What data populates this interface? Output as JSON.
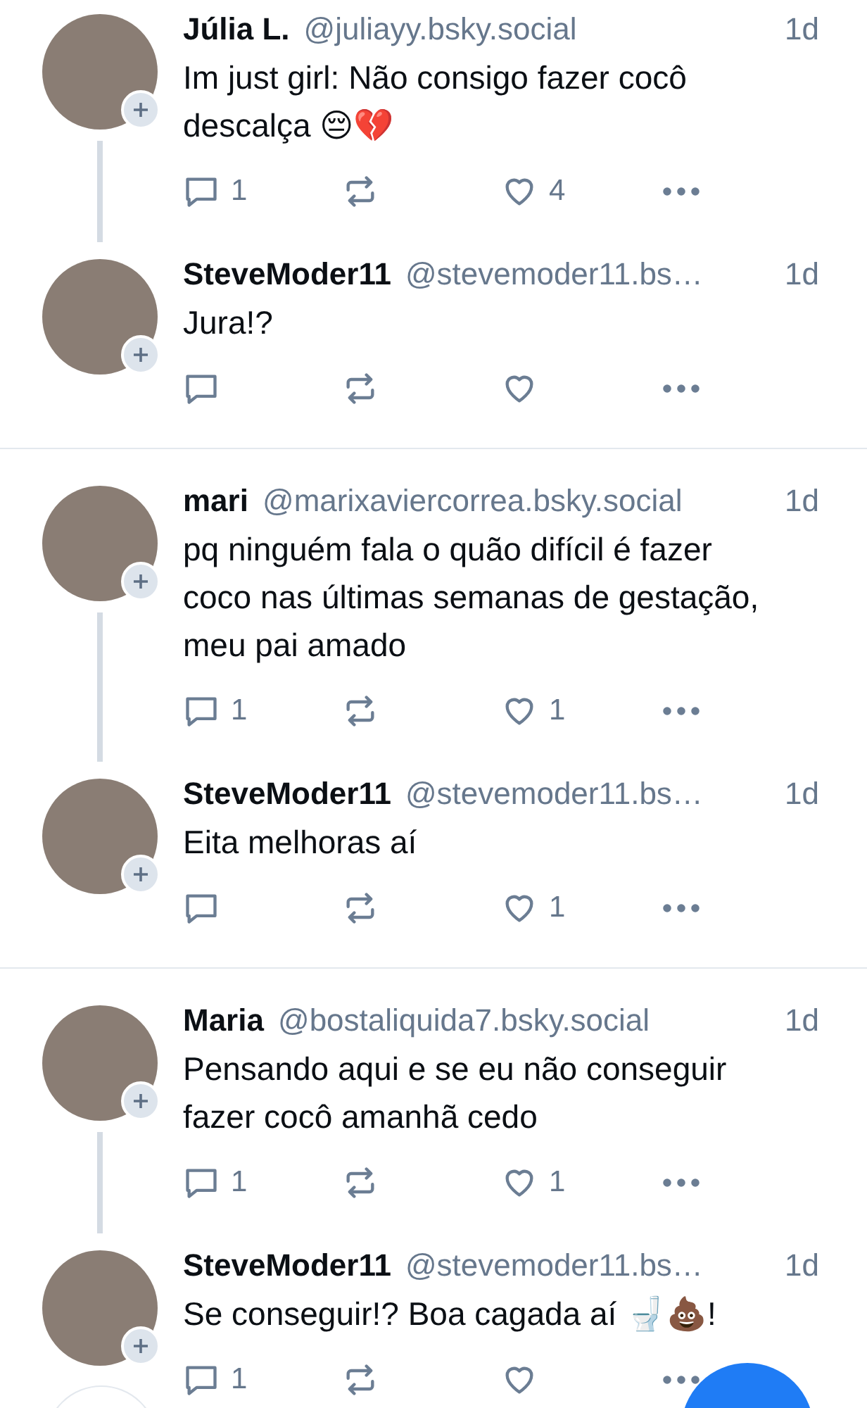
{
  "threads": [
    {
      "posts": [
        {
          "name": "Júlia L.",
          "handle": "@juliayy.bsky.social",
          "time": "1d",
          "text": "Im just girl: Não consigo fazer cocô descalça 😔💔",
          "replies": "1",
          "likes": "4",
          "liked": false
        },
        {
          "name": "SteveModer11",
          "handle": "@stevemoder11.bs…",
          "time": "1d",
          "text": "Jura!?",
          "liked": false
        }
      ]
    },
    {
      "posts": [
        {
          "name": "mari",
          "handle": "@marixaviercorrea.bsky.social",
          "time": "1d",
          "text": "pq ninguém fala o quão difícil é fazer coco nas últimas semanas de gestação, meu pai amado",
          "replies": "1",
          "likes": "1",
          "liked": false
        },
        {
          "name": "SteveModer11",
          "handle": "@stevemoder11.bs…",
          "time": "1d",
          "text": "Eita melhoras aí",
          "likes": "1",
          "liked": false
        }
      ]
    },
    {
      "posts": [
        {
          "name": "Maria",
          "handle": "@bostaliquida7.bsky.social",
          "time": "1d",
          "text": "Pensando aqui e se eu não conseguir fazer cocô amanhã cedo",
          "replies": "1",
          "likes": "1",
          "liked": false
        },
        {
          "name": "SteveModer11",
          "handle": "@stevemoder11.bs…",
          "time": "1d",
          "text": "Se conseguir!? Boa cagada aí 🚽💩!",
          "replies": "1",
          "liked": false
        }
      ]
    }
  ]
}
